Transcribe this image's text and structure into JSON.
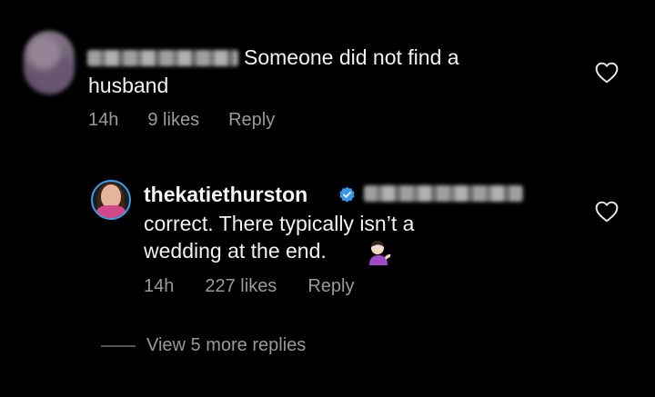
{
  "comment": {
    "text_line1": "Someone did not find a",
    "text_line2": "husband",
    "time": "14h",
    "likes": "9 likes",
    "reply_label": "Reply"
  },
  "reply": {
    "username": "thekatiethurston",
    "text_line1": "correct. There typically isn’t a",
    "text_line2": "wedding at the end.",
    "time": "14h",
    "likes": "227 likes",
    "reply_label": "Reply"
  },
  "view_more": "View 5 more replies",
  "icons": {
    "like": "heart-outline-icon",
    "verified": "verified-badge-icon",
    "emoji": "person-tipping-hand-emoji"
  },
  "colors": {
    "background": "#000000",
    "text": "#f5f5f5",
    "meta": "#9a9a9a",
    "verified": "#3897f0"
  }
}
